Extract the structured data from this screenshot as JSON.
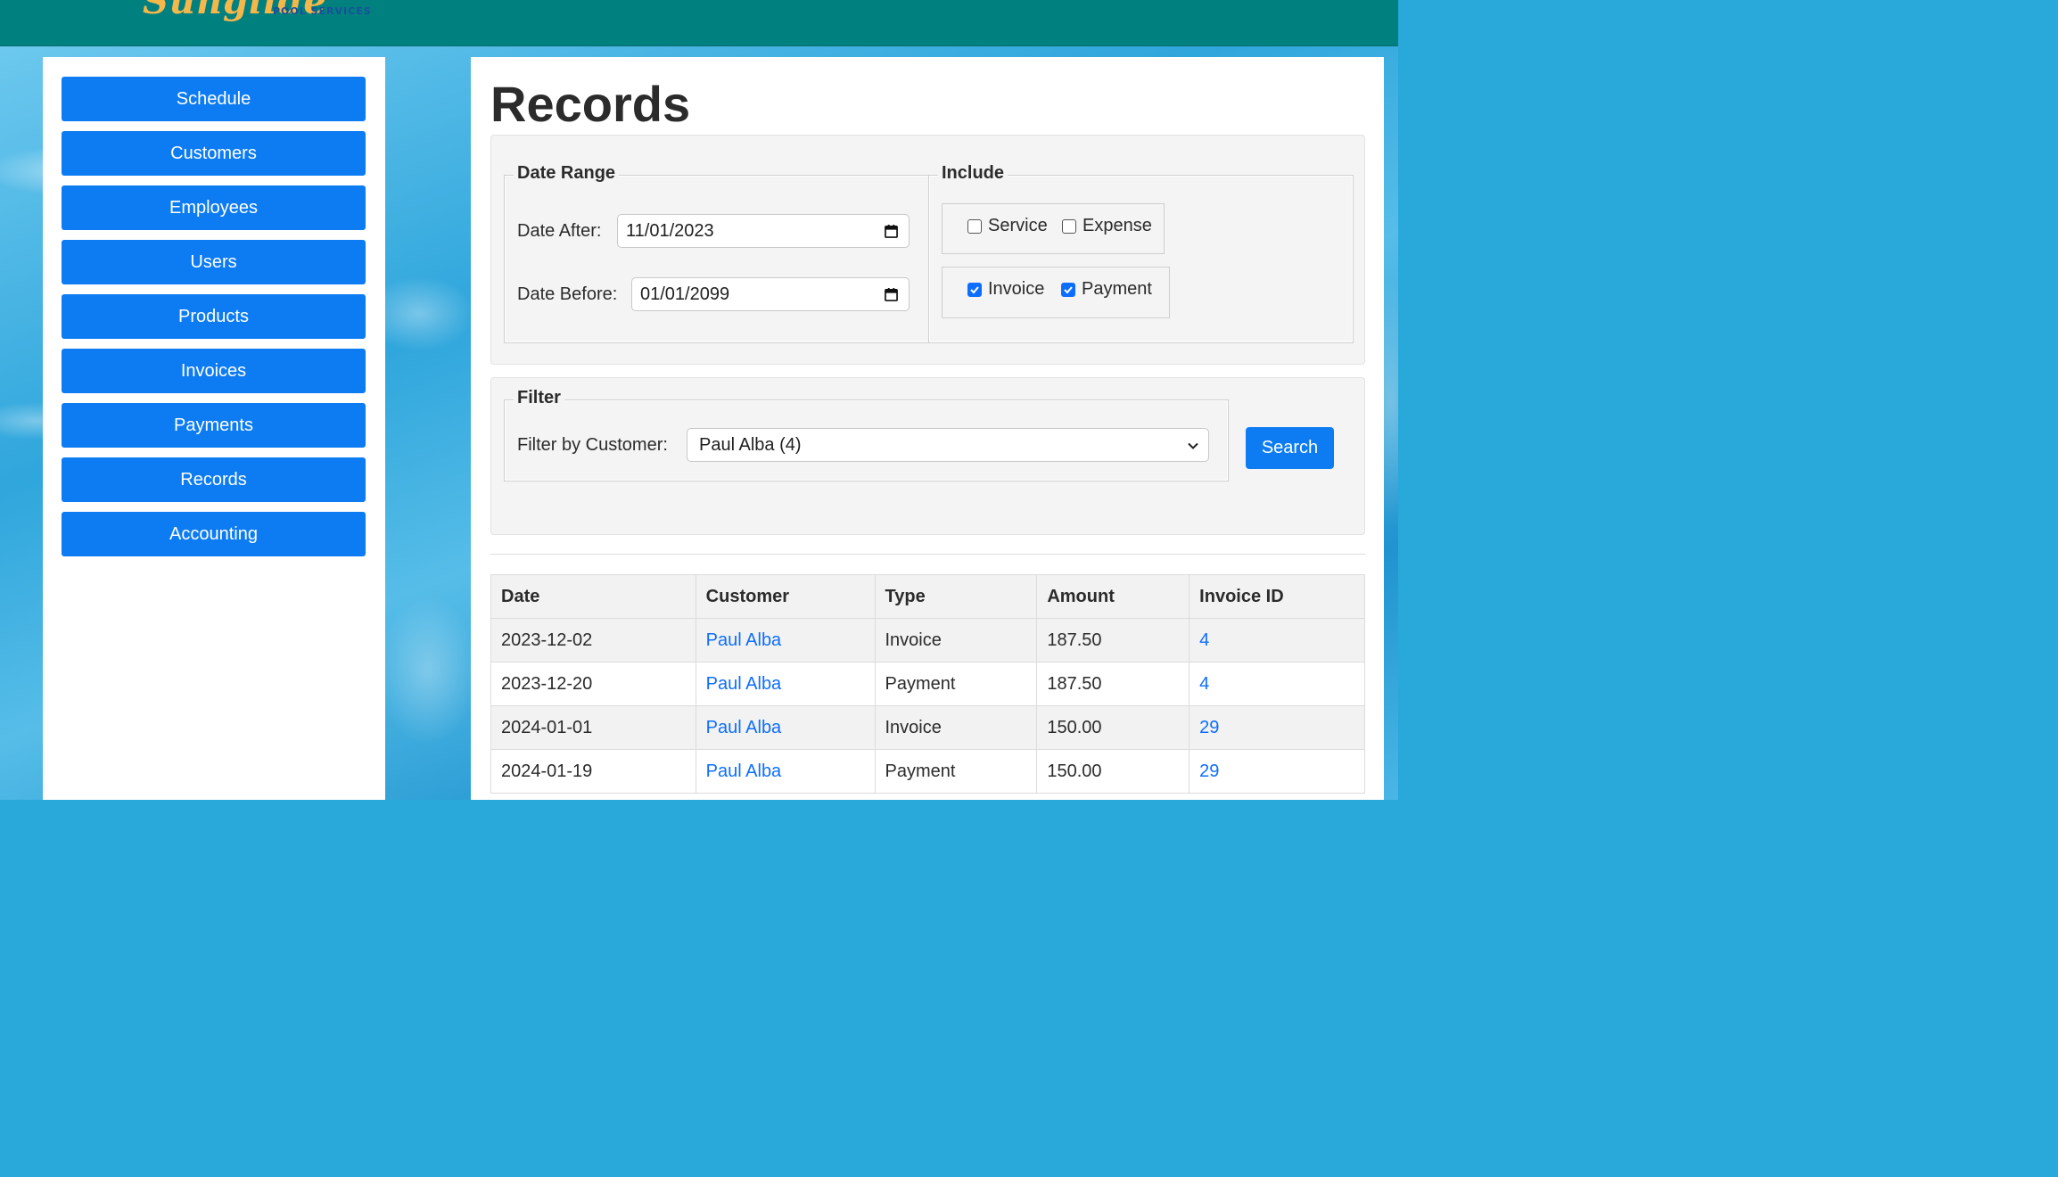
{
  "header": {
    "logo_script": "Sunglide",
    "logo_sub": "POOL SERVICES"
  },
  "sidebar": {
    "items": [
      {
        "label": "Schedule"
      },
      {
        "label": "Customers"
      },
      {
        "label": "Employees"
      },
      {
        "label": "Users"
      },
      {
        "label": "Products"
      },
      {
        "label": "Invoices"
      },
      {
        "label": "Payments"
      },
      {
        "label": "Records"
      },
      {
        "label": "Accounting"
      }
    ]
  },
  "main": {
    "title": "Records",
    "date_range": {
      "legend": "Date Range",
      "after_label": "Date After:",
      "after_value": "11/01/2023",
      "before_label": "Date Before:",
      "before_value": "01/01/2099"
    },
    "include": {
      "legend": "Include",
      "service": {
        "label": "Service",
        "checked": false
      },
      "expense": {
        "label": "Expense",
        "checked": false
      },
      "invoice": {
        "label": "Invoice",
        "checked": true
      },
      "payment": {
        "label": "Payment",
        "checked": true
      }
    },
    "filter": {
      "legend": "Filter",
      "customer_label": "Filter by Customer:",
      "customer_value": "Paul Alba (4)"
    },
    "search_label": "Search",
    "table": {
      "headers": [
        "Date",
        "Customer",
        "Type",
        "Amount",
        "Invoice ID"
      ],
      "rows": [
        [
          "2023-12-02",
          "Paul Alba",
          "Invoice",
          "187.50",
          "4"
        ],
        [
          "2023-12-20",
          "Paul Alba",
          "Payment",
          "187.50",
          "4"
        ],
        [
          "2024-01-01",
          "Paul Alba",
          "Invoice",
          "150.00",
          "29"
        ],
        [
          "2024-01-19",
          "Paul Alba",
          "Payment",
          "150.00",
          "29"
        ]
      ]
    }
  },
  "colors": {
    "header": "#00807f",
    "nav_button": "#0d7cf2",
    "link": "#0d6efd",
    "logo": "#f5b74a"
  }
}
